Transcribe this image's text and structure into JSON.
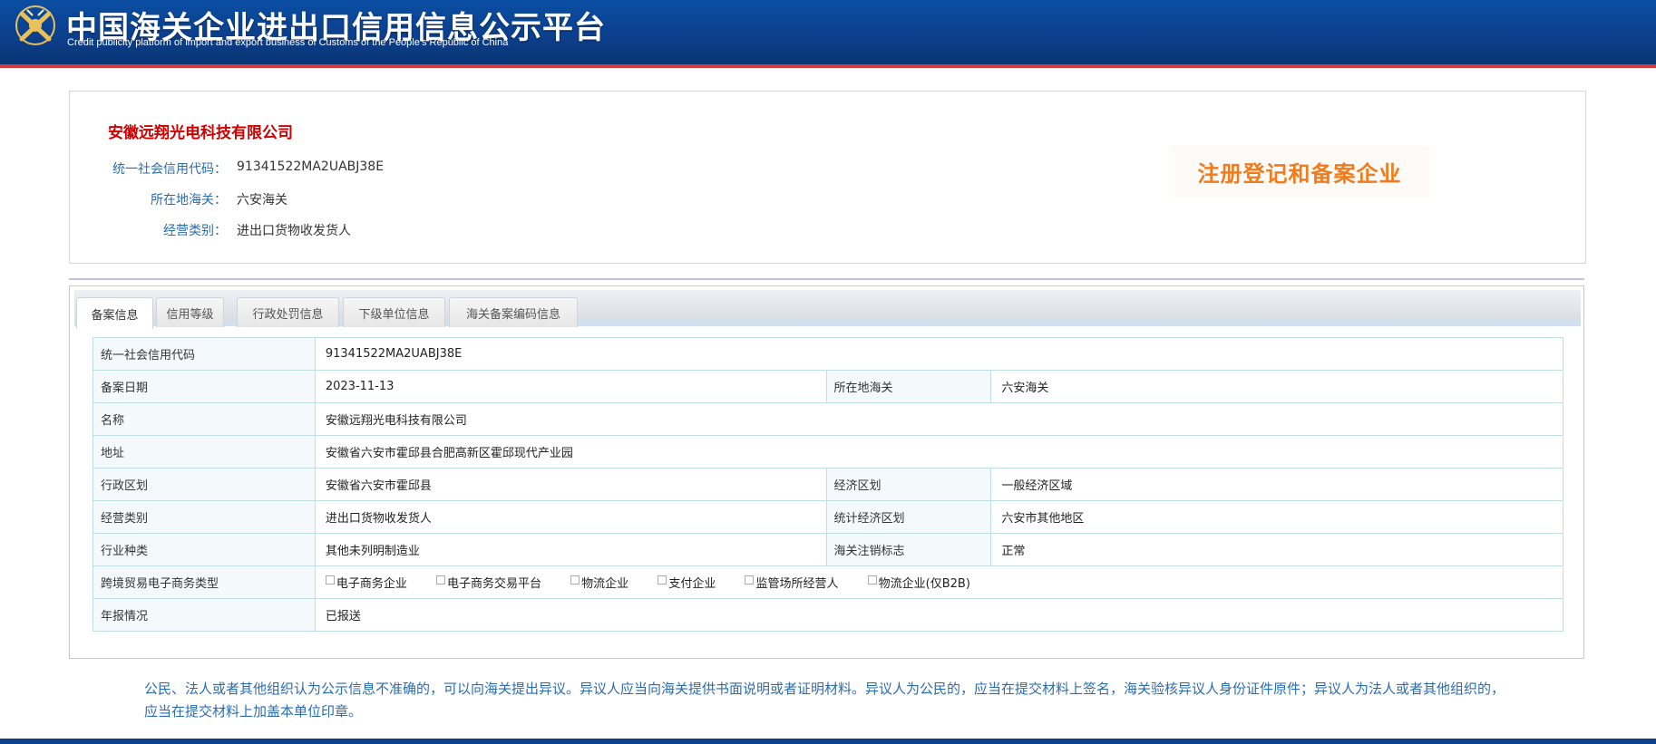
{
  "header": {
    "title": "中国海关企业进出口信用信息公示平台",
    "subtitle": "Credit publicity platform of import and export business of Customs of the People's Republic of China",
    "logo_icon": "customs-emblem-icon"
  },
  "company": {
    "name": "安徽远翔光电科技有限公司",
    "fields": [
      {
        "label": "统一社会信用代码：",
        "value": "91341522MA2UABJ38E"
      },
      {
        "label": "所在地海关：",
        "value": "六安海关"
      },
      {
        "label": "经营类别：",
        "value": "进出口货物收发货人"
      }
    ],
    "stamp": "注册登记和备案企业"
  },
  "tabs": [
    {
      "label": "备案信息"
    },
    {
      "label": "信用等级"
    },
    {
      "label": "行政处罚信息"
    },
    {
      "label": "下级单位信息"
    },
    {
      "label": "海关备案编码信息"
    }
  ],
  "record": {
    "credit_code_label": "统一社会信用代码",
    "credit_code": "91341522MA2UABJ38E",
    "date_label": "备案日期",
    "date": "2023-11-13",
    "customs_label": "所在地海关",
    "customs": "六安海关",
    "name_label": "名称",
    "name": "安徽远翔光电科技有限公司",
    "address_label": "地址",
    "address": "安徽省六安市霍邱县合肥高新区霍邱现代产业园",
    "region_label": "行政区划",
    "region": "安徽省六安市霍邱县",
    "econ_zone_label": "经济区划",
    "econ_zone": "一般经济区域",
    "business_label": "经营类别",
    "business": "进出口货物收发货人",
    "stat_zone_label": "统计经济区划",
    "stat_zone": "六安市其他地区",
    "industry_label": "行业种类",
    "industry": "其他未列明制造业",
    "cancel_label": "海关注销标志",
    "cancel": "正常",
    "ecommerce_label": "跨境贸易电子商务类型",
    "ecommerce_options": [
      "电子商务企业",
      "电子商务交易平台",
      "物流企业",
      "支付企业",
      "监管场所经营人",
      "物流企业(仅B2B)"
    ],
    "annual_label": "年报情况",
    "annual": "已报送"
  },
  "notice": "公民、法人或者其他组织认为公示信息不准确的，可以向海关提出异议。异议人应当向海关提供书面说明或者证明材料。异议人为公民的，应当在提交材料上签名，海关验核异议人身份证件原件；异议人为法人或者其他组织的，应当在提交材料上加盖本单位印章。"
}
